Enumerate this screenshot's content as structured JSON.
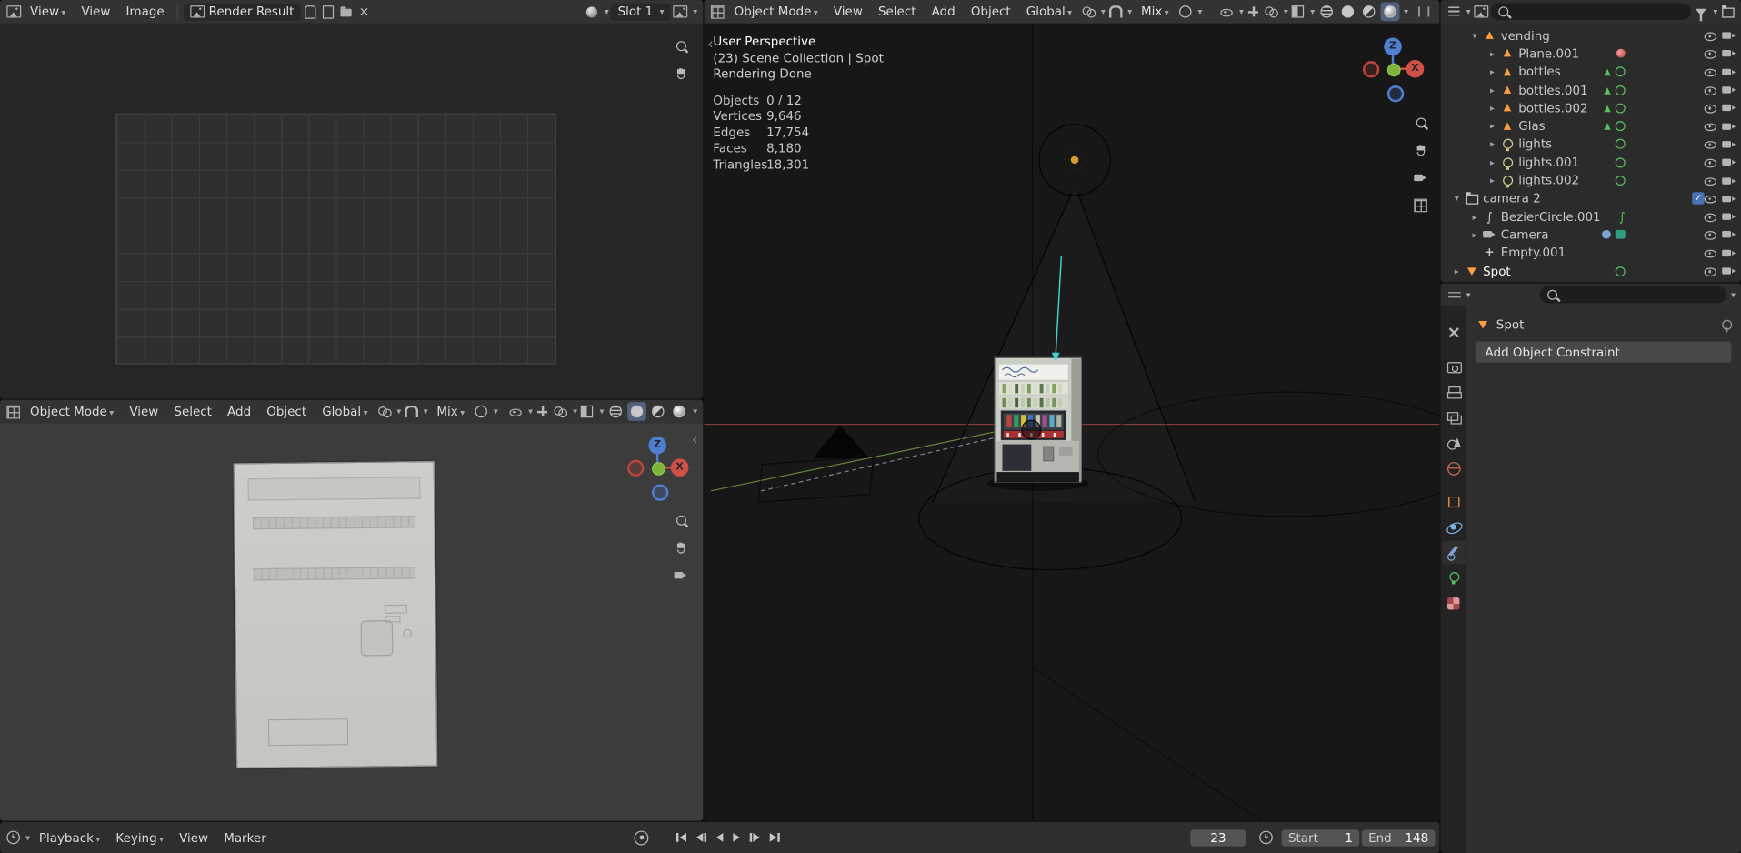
{
  "colors": {
    "accent_blue": "#4772b3",
    "axis_x": "#e0433d",
    "axis_y": "#7fbe3a",
    "axis_z": "#3f7fd2",
    "mesh_icon_orange": "#ff9e40",
    "data_icon_green": "#58c05a",
    "constraint_line_cyan": "#3fd4d4"
  },
  "icons": {
    "checkbox": "✓",
    "disclosure_open": "▾",
    "disclosure_closed": "▸",
    "chevron_left": "‹",
    "caret": "▾",
    "mesh": "▲",
    "curve": "∫",
    "empty": "+",
    "bars": "❙❙"
  },
  "image_editor": {
    "mode": "View",
    "menus": [
      "View",
      "Image"
    ],
    "image_name": "Render Result",
    "slot": "Slot 1"
  },
  "viewport_small": {
    "mode": "Object Mode",
    "menus": [
      "View",
      "Select",
      "Add",
      "Object"
    ],
    "orientation": "Global",
    "blend": "Mix",
    "axis_z": "Z",
    "axis_x": "X"
  },
  "viewport_main": {
    "mode": "Object Mode",
    "menus": [
      "View",
      "Select",
      "Add",
      "Object"
    ],
    "orientation": "Global",
    "blend": "Mix",
    "axis_z": "Z",
    "axis_x": "X",
    "overlay": {
      "view": "User Perspective",
      "context": "(23) Scene Collection | Spot",
      "status": "Rendering Done",
      "stats": [
        {
          "label": "Objects",
          "value": "0 / 12"
        },
        {
          "label": "Vertices",
          "value": "9,646"
        },
        {
          "label": "Edges",
          "value": "17,754"
        },
        {
          "label": "Faces",
          "value": "8,180"
        },
        {
          "label": "Triangles",
          "value": "18,301"
        }
      ]
    }
  },
  "outliner": {
    "rows": [
      {
        "label": "vending",
        "icon": "mesh",
        "extras": []
      },
      {
        "label": "Plane.001",
        "icon": "mesh",
        "extras": [
          "material"
        ]
      },
      {
        "label": "bottles",
        "icon": "mesh",
        "extras": [
          "mesh-data",
          "node-tree"
        ]
      },
      {
        "label": "bottles.001",
        "icon": "mesh",
        "extras": [
          "mesh-data",
          "node-tree"
        ]
      },
      {
        "label": "bottles.002",
        "icon": "mesh",
        "extras": [
          "mesh-data",
          "node-tree"
        ]
      },
      {
        "label": "Glas",
        "icon": "mesh",
        "extras": [
          "mesh-data",
          "node-tree"
        ]
      },
      {
        "label": "lights",
        "icon": "light",
        "extras": [
          "node-tree"
        ]
      },
      {
        "label": "lights.001",
        "icon": "light",
        "extras": [
          "node-tree"
        ]
      },
      {
        "label": "lights.002",
        "icon": "light",
        "extras": [
          "node-tree"
        ]
      },
      {
        "label": "camera 2",
        "icon": "collection",
        "extras": [],
        "checkbox": true
      },
      {
        "label": "BezierCircle.001",
        "icon": "curve",
        "extras": [
          "curve-data"
        ]
      },
      {
        "label": "Camera",
        "icon": "camera",
        "extras": [
          "constraint",
          "camera-data"
        ]
      },
      {
        "label": "Empty.001",
        "icon": "empty",
        "extras": []
      },
      {
        "label": "Spot",
        "icon": "spot-light",
        "extras": [
          "node-tree"
        ],
        "active": true
      }
    ]
  },
  "properties": {
    "tabs": [
      "tool",
      "render",
      "output",
      "view-layer",
      "scene",
      "world",
      "object",
      "physics",
      "constraints",
      "object-data",
      "texture"
    ],
    "active_tab": "constraints",
    "breadcrumb": "Spot",
    "add_constraint_label": "Add Object Constraint"
  },
  "timeline": {
    "menus": [
      "Playback",
      "Keying",
      "View",
      "Marker"
    ],
    "current_frame": "23",
    "start_label": "Start",
    "start_value": "1",
    "end_label": "End",
    "end_value": "148"
  }
}
